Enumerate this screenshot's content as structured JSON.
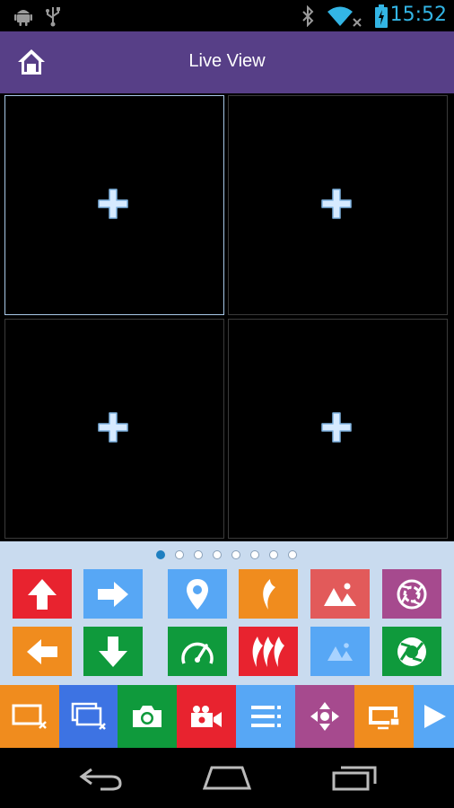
{
  "status": {
    "time": "15:52",
    "icons": [
      "android-icon",
      "usb-icon",
      "bluetooth-icon",
      "wifi-icon",
      "battery-icon"
    ]
  },
  "header": {
    "title": "Live View",
    "home_icon": "home-icon"
  },
  "grid": {
    "cells": [
      {
        "icon": "add-icon"
      },
      {
        "icon": "add-icon"
      },
      {
        "icon": "add-icon"
      },
      {
        "icon": "add-icon"
      }
    ],
    "selected_index": 0
  },
  "pager": {
    "count": 8,
    "active": 0
  },
  "controls": [
    {
      "icon": "arrow-up-icon",
      "color": "#e8232f"
    },
    {
      "icon": "arrow-right-icon",
      "color": "#57a7f5"
    },
    {
      "icon": "location-pin-icon",
      "color": "#57a7f5"
    },
    {
      "icon": "focus-icon",
      "color": "#f08c1e"
    },
    {
      "icon": "zoom-in-icon",
      "color": "#e25a5a"
    },
    {
      "icon": "iris-open-icon",
      "color": "#a64a8e"
    },
    {
      "icon": "arrow-left-icon",
      "color": "#f08c1e"
    },
    {
      "icon": "arrow-down-icon",
      "color": "#0f9a3c"
    },
    {
      "icon": "speed-icon",
      "color": "#0f9a3c"
    },
    {
      "icon": "focus-far-icon",
      "color": "#e8232f"
    },
    {
      "icon": "zoom-out-icon",
      "color": "#57a7f5"
    },
    {
      "icon": "iris-close-icon",
      "color": "#0f9a3c"
    }
  ],
  "toolbar": [
    {
      "icon": "close-window-icon",
      "color": "#f08c1e"
    },
    {
      "icon": "close-all-icon",
      "color": "#3d73e3"
    },
    {
      "icon": "camera-icon",
      "color": "#0f9a3c"
    },
    {
      "icon": "record-icon",
      "color": "#e8232f"
    },
    {
      "icon": "menu-icon",
      "color": "#57a7f5"
    },
    {
      "icon": "ptz-icon",
      "color": "#a64a8e"
    },
    {
      "icon": "screen-icon",
      "color": "#f08c1e"
    },
    {
      "icon": "play-icon",
      "color": "#57a7f5"
    }
  ],
  "nav": [
    "back-icon",
    "home-nav-icon",
    "recents-icon"
  ]
}
